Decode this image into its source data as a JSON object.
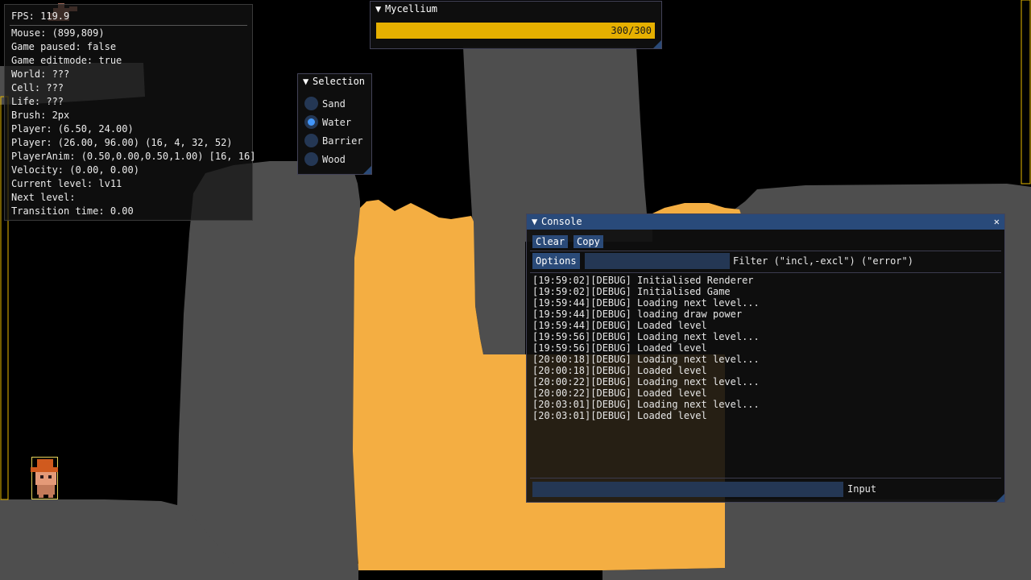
{
  "colors": {
    "background": "#000000",
    "terrain": "#4e4e4e",
    "liquid": "#f4ae42",
    "progress_fill": "#e6b000",
    "accent": "#4296fa"
  },
  "debug": {
    "lines": [
      "FPS: 119.9",
      "Mouse: (899,809)",
      "Game paused: false",
      "Game editmode: true",
      "World: ???",
      "Cell: ???",
      "Life: ???",
      "Brush: 2px",
      "Player: (6.50, 24.00)",
      "Player: (26.00, 96.00) (16, 4, 32, 52)",
      "PlayerAnim: (0.50,0.00,0.50,1.00) [16, 16]",
      "Velocity: (0.00, 0.00)",
      "Current level: lv11",
      "Next level:",
      "Transition time: 0.00"
    ]
  },
  "mycellium": {
    "title": "Mycellium",
    "progress_text": "300/300",
    "progress_fraction": 1.0
  },
  "selection": {
    "title": "Selection",
    "options": [
      {
        "label": "Sand",
        "selected": false
      },
      {
        "label": "Water",
        "selected": true
      },
      {
        "label": "Barrier",
        "selected": false
      },
      {
        "label": "Wood",
        "selected": false
      }
    ]
  },
  "console": {
    "title": "Console",
    "close_label": "✕",
    "clear_label": "Clear",
    "copy_label": "Copy",
    "options_label": "Options",
    "filter_label": "Filter (\"incl,-excl\") (\"error\")",
    "filter_value": "",
    "input_label": "Input",
    "input_value": "",
    "logs": [
      "[19:59:02][DEBUG] Initialised Renderer",
      "[19:59:02][DEBUG] Initialised Game",
      "[19:59:44][DEBUG] Loading next level...",
      "[19:59:44][DEBUG] loading draw power",
      "[19:59:44][DEBUG] Loaded level",
      "[19:59:56][DEBUG] Loading next level...",
      "[19:59:56][DEBUG] Loaded level",
      "[20:00:18][DEBUG] Loading next level...",
      "[20:00:18][DEBUG] Loaded level",
      "[20:00:22][DEBUG] Loading next level...",
      "[20:00:22][DEBUG] Loaded level",
      "[20:03:01][DEBUG] Loading next level...",
      "[20:03:01][DEBUG] Loaded level"
    ]
  }
}
